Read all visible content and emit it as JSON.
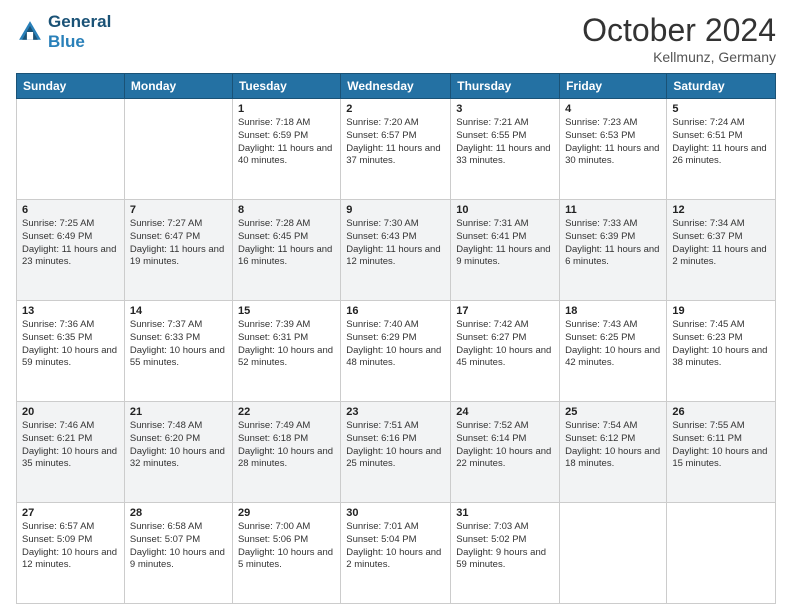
{
  "header": {
    "logo_line1": "General",
    "logo_line2": "Blue",
    "month": "October 2024",
    "location": "Kellmunz, Germany"
  },
  "weekdays": [
    "Sunday",
    "Monday",
    "Tuesday",
    "Wednesday",
    "Thursday",
    "Friday",
    "Saturday"
  ],
  "weeks": [
    [
      {
        "day": "",
        "sunrise": "",
        "sunset": "",
        "daylight": ""
      },
      {
        "day": "",
        "sunrise": "",
        "sunset": "",
        "daylight": ""
      },
      {
        "day": "1",
        "sunrise": "Sunrise: 7:18 AM",
        "sunset": "Sunset: 6:59 PM",
        "daylight": "Daylight: 11 hours and 40 minutes."
      },
      {
        "day": "2",
        "sunrise": "Sunrise: 7:20 AM",
        "sunset": "Sunset: 6:57 PM",
        "daylight": "Daylight: 11 hours and 37 minutes."
      },
      {
        "day": "3",
        "sunrise": "Sunrise: 7:21 AM",
        "sunset": "Sunset: 6:55 PM",
        "daylight": "Daylight: 11 hours and 33 minutes."
      },
      {
        "day": "4",
        "sunrise": "Sunrise: 7:23 AM",
        "sunset": "Sunset: 6:53 PM",
        "daylight": "Daylight: 11 hours and 30 minutes."
      },
      {
        "day": "5",
        "sunrise": "Sunrise: 7:24 AM",
        "sunset": "Sunset: 6:51 PM",
        "daylight": "Daylight: 11 hours and 26 minutes."
      }
    ],
    [
      {
        "day": "6",
        "sunrise": "Sunrise: 7:25 AM",
        "sunset": "Sunset: 6:49 PM",
        "daylight": "Daylight: 11 hours and 23 minutes."
      },
      {
        "day": "7",
        "sunrise": "Sunrise: 7:27 AM",
        "sunset": "Sunset: 6:47 PM",
        "daylight": "Daylight: 11 hours and 19 minutes."
      },
      {
        "day": "8",
        "sunrise": "Sunrise: 7:28 AM",
        "sunset": "Sunset: 6:45 PM",
        "daylight": "Daylight: 11 hours and 16 minutes."
      },
      {
        "day": "9",
        "sunrise": "Sunrise: 7:30 AM",
        "sunset": "Sunset: 6:43 PM",
        "daylight": "Daylight: 11 hours and 12 minutes."
      },
      {
        "day": "10",
        "sunrise": "Sunrise: 7:31 AM",
        "sunset": "Sunset: 6:41 PM",
        "daylight": "Daylight: 11 hours and 9 minutes."
      },
      {
        "day": "11",
        "sunrise": "Sunrise: 7:33 AM",
        "sunset": "Sunset: 6:39 PM",
        "daylight": "Daylight: 11 hours and 6 minutes."
      },
      {
        "day": "12",
        "sunrise": "Sunrise: 7:34 AM",
        "sunset": "Sunset: 6:37 PM",
        "daylight": "Daylight: 11 hours and 2 minutes."
      }
    ],
    [
      {
        "day": "13",
        "sunrise": "Sunrise: 7:36 AM",
        "sunset": "Sunset: 6:35 PM",
        "daylight": "Daylight: 10 hours and 59 minutes."
      },
      {
        "day": "14",
        "sunrise": "Sunrise: 7:37 AM",
        "sunset": "Sunset: 6:33 PM",
        "daylight": "Daylight: 10 hours and 55 minutes."
      },
      {
        "day": "15",
        "sunrise": "Sunrise: 7:39 AM",
        "sunset": "Sunset: 6:31 PM",
        "daylight": "Daylight: 10 hours and 52 minutes."
      },
      {
        "day": "16",
        "sunrise": "Sunrise: 7:40 AM",
        "sunset": "Sunset: 6:29 PM",
        "daylight": "Daylight: 10 hours and 48 minutes."
      },
      {
        "day": "17",
        "sunrise": "Sunrise: 7:42 AM",
        "sunset": "Sunset: 6:27 PM",
        "daylight": "Daylight: 10 hours and 45 minutes."
      },
      {
        "day": "18",
        "sunrise": "Sunrise: 7:43 AM",
        "sunset": "Sunset: 6:25 PM",
        "daylight": "Daylight: 10 hours and 42 minutes."
      },
      {
        "day": "19",
        "sunrise": "Sunrise: 7:45 AM",
        "sunset": "Sunset: 6:23 PM",
        "daylight": "Daylight: 10 hours and 38 minutes."
      }
    ],
    [
      {
        "day": "20",
        "sunrise": "Sunrise: 7:46 AM",
        "sunset": "Sunset: 6:21 PM",
        "daylight": "Daylight: 10 hours and 35 minutes."
      },
      {
        "day": "21",
        "sunrise": "Sunrise: 7:48 AM",
        "sunset": "Sunset: 6:20 PM",
        "daylight": "Daylight: 10 hours and 32 minutes."
      },
      {
        "day": "22",
        "sunrise": "Sunrise: 7:49 AM",
        "sunset": "Sunset: 6:18 PM",
        "daylight": "Daylight: 10 hours and 28 minutes."
      },
      {
        "day": "23",
        "sunrise": "Sunrise: 7:51 AM",
        "sunset": "Sunset: 6:16 PM",
        "daylight": "Daylight: 10 hours and 25 minutes."
      },
      {
        "day": "24",
        "sunrise": "Sunrise: 7:52 AM",
        "sunset": "Sunset: 6:14 PM",
        "daylight": "Daylight: 10 hours and 22 minutes."
      },
      {
        "day": "25",
        "sunrise": "Sunrise: 7:54 AM",
        "sunset": "Sunset: 6:12 PM",
        "daylight": "Daylight: 10 hours and 18 minutes."
      },
      {
        "day": "26",
        "sunrise": "Sunrise: 7:55 AM",
        "sunset": "Sunset: 6:11 PM",
        "daylight": "Daylight: 10 hours and 15 minutes."
      }
    ],
    [
      {
        "day": "27",
        "sunrise": "Sunrise: 6:57 AM",
        "sunset": "Sunset: 5:09 PM",
        "daylight": "Daylight: 10 hours and 12 minutes."
      },
      {
        "day": "28",
        "sunrise": "Sunrise: 6:58 AM",
        "sunset": "Sunset: 5:07 PM",
        "daylight": "Daylight: 10 hours and 9 minutes."
      },
      {
        "day": "29",
        "sunrise": "Sunrise: 7:00 AM",
        "sunset": "Sunset: 5:06 PM",
        "daylight": "Daylight: 10 hours and 5 minutes."
      },
      {
        "day": "30",
        "sunrise": "Sunrise: 7:01 AM",
        "sunset": "Sunset: 5:04 PM",
        "daylight": "Daylight: 10 hours and 2 minutes."
      },
      {
        "day": "31",
        "sunrise": "Sunrise: 7:03 AM",
        "sunset": "Sunset: 5:02 PM",
        "daylight": "Daylight: 9 hours and 59 minutes."
      },
      {
        "day": "",
        "sunrise": "",
        "sunset": "",
        "daylight": ""
      },
      {
        "day": "",
        "sunrise": "",
        "sunset": "",
        "daylight": ""
      }
    ]
  ]
}
